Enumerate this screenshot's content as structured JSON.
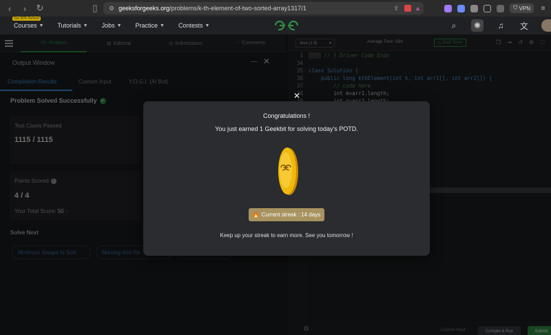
{
  "browser": {
    "url_host": "geeksforgeeks.org",
    "url_path": "/problems/k-th-element-of-two-sorted-array1317/1",
    "vpn_label": "VPN"
  },
  "header": {
    "refund_badge": "Get 90% Refund",
    "menu": [
      "Courses",
      "Tutorials",
      "Jobs",
      "Practice",
      "Contests"
    ]
  },
  "problem_tabs": [
    "Problem",
    "Editorial",
    "Submissions",
    "Comments"
  ],
  "output": {
    "title": "Output Window",
    "tabs": [
      "Compilation Results",
      "Custom Input",
      "Y.O.G.I. (AI Bot)"
    ],
    "status": "Problem Solved Successfully",
    "test_cases_label": "Test Cases Passed",
    "test_cases_value": "1115 / 1115",
    "points_label": "Points Scored",
    "points_value": "4 / 4",
    "total_label": "Your Total Score:",
    "total_value": "50",
    "solve_next_label": "Solve Next",
    "solve_next": [
      "Minimum Swaps to Sort",
      "Missing And Re..."
    ]
  },
  "editor": {
    "language": "Java (1.8)",
    "average_time": "Average Time: 15m",
    "start_timer": "Start Timer",
    "lines": [
      {
        "n": "1",
        "text": "// } Driver Code Ends"
      },
      {
        "n": "34",
        "text": ""
      },
      {
        "n": "35",
        "text": "class Solution {"
      },
      {
        "n": "36",
        "text": "    public long kthElement(int k, int arr1[], int arr2[]) {"
      },
      {
        "n": "37",
        "text": "        // code here"
      },
      {
        "n": "38",
        "text": "        int m=arr1.length;"
      },
      {
        "n": "39",
        "text": "        int n=arr2.length;"
      }
    ],
    "custom_input": "Custom Input",
    "compile_run": "Compile & Run",
    "submit": "Submit"
  },
  "modal": {
    "title": "Congratulations !",
    "subtitle": "You just earned 1 Geekbit for solving today's POTD.",
    "streak": "Current streak : 14 days",
    "footer": "Keep up your streak to earn more. See you tomorrow !"
  },
  "colors": {
    "brand_green": "#2f8d46",
    "link_blue": "#3b8fd8",
    "coin_gold": "#f0b90b",
    "streak_bg": "#a89360"
  }
}
